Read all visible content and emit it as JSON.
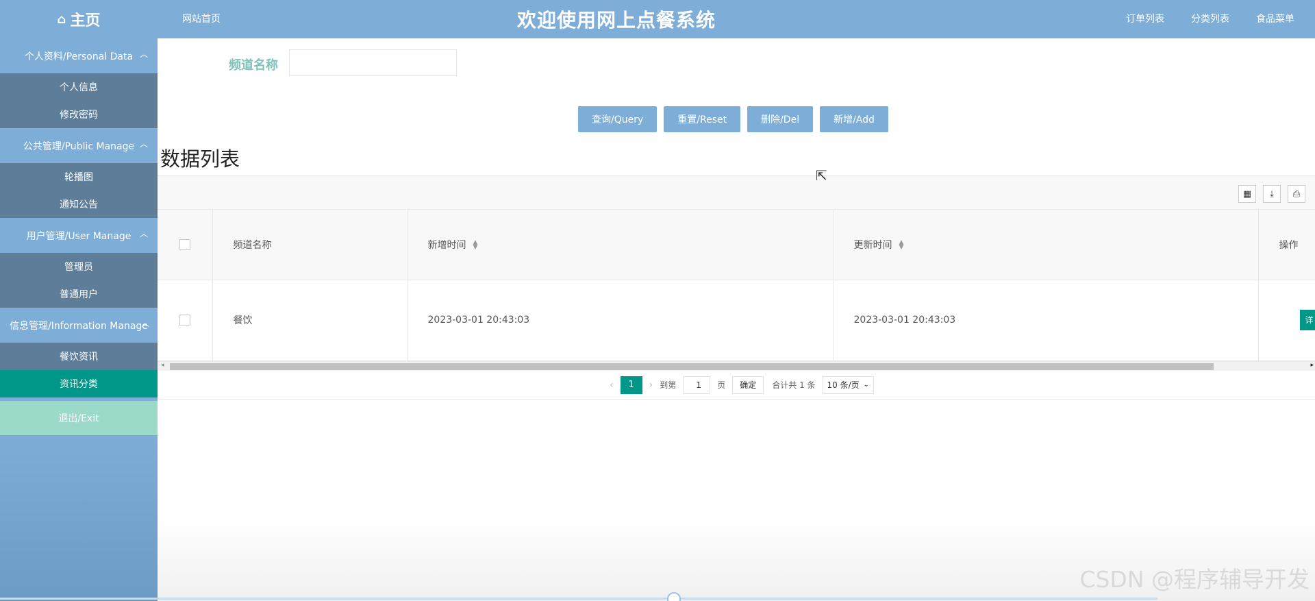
{
  "brand": {
    "label": "主页",
    "icon": "home-icon"
  },
  "header": {
    "home_link": "网站首页",
    "title": "欢迎使用网上点餐系统",
    "nav": [
      "订单列表",
      "分类列表",
      "食品菜单"
    ]
  },
  "sidebar": {
    "groups": [
      {
        "label": "个人资料/Personal Data",
        "items": [
          {
            "label": "个人信息"
          },
          {
            "label": "修改密码"
          }
        ]
      },
      {
        "label": "公共管理/Public Manage",
        "items": [
          {
            "label": "轮播图"
          },
          {
            "label": "通知公告"
          }
        ]
      },
      {
        "label": "用户管理/User Manage",
        "items": [
          {
            "label": "管理员"
          },
          {
            "label": "普通用户"
          }
        ]
      },
      {
        "label": "信息管理/Information Manage",
        "items": [
          {
            "label": "餐饮资讯"
          },
          {
            "label": "资讯分类",
            "active": true
          }
        ]
      }
    ],
    "exit_label": "退出/Exit"
  },
  "search": {
    "label": "频道名称",
    "value": ""
  },
  "buttons": {
    "query": "查询/Query",
    "reset": "重置/Reset",
    "delete": "删除/Del",
    "add": "新增/Add"
  },
  "section_title": "数据列表",
  "table": {
    "columns": [
      "频道名称",
      "新增时间",
      "更新时间",
      "操作"
    ],
    "rows": [
      {
        "name": "餐饮",
        "created": "2023-03-01 20:43:03",
        "updated": "2023-03-01 20:43:03",
        "action": "详"
      }
    ]
  },
  "pagination": {
    "current_page": "1",
    "goto_prefix": "到第",
    "goto_value": "1",
    "goto_suffix": "页",
    "confirm": "确定",
    "total": "合计共 1 条",
    "page_size": "10 条/页"
  },
  "watermark": "CSDN @程序辅导开发",
  "colors": {
    "header": "#7eaed8",
    "sidebar_sub": "#5e7d99",
    "active": "#009688",
    "exit": "#9bd9c8",
    "label": "#7ec2b8"
  }
}
